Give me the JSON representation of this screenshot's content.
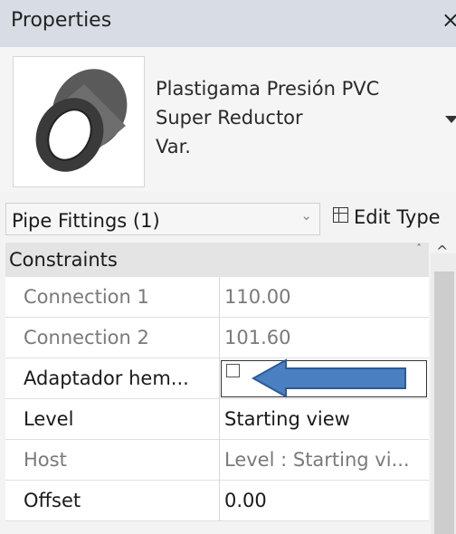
{
  "window": {
    "title": "Properties",
    "close_glyph": "×"
  },
  "type_selector": {
    "line1": "Plastigama Presión PVC",
    "line2": "Super Reductor",
    "line3": "Var.",
    "thumbnail_icon": "pipe-reducer-icon"
  },
  "selection": {
    "category": "Pipe Fittings (1)",
    "dropdown_glyph": "⌄",
    "edit_type_label": "Edit Type"
  },
  "grid": {
    "group": "Constraints",
    "group_toggle": "ˆ",
    "rows": [
      {
        "name": "Connection 1",
        "value": "110.00",
        "readonly": true
      },
      {
        "name": "Connection 2",
        "value": "101.60",
        "readonly": true
      },
      {
        "name": "Adaptador hem...",
        "value": "",
        "readonly": false,
        "checked": false
      },
      {
        "name": "Level",
        "value": "Starting view",
        "readonly": false
      },
      {
        "name": "Host",
        "value": "Level : Starting vi...",
        "readonly": true
      },
      {
        "name": "Offset",
        "value": "0.00",
        "readonly": false
      }
    ]
  },
  "scrollbar": {
    "up_glyph": "^"
  },
  "colors": {
    "arrow_fill": "#4a7fc1",
    "arrow_stroke": "#2e5a94",
    "titlebar": "#d8dde5"
  }
}
